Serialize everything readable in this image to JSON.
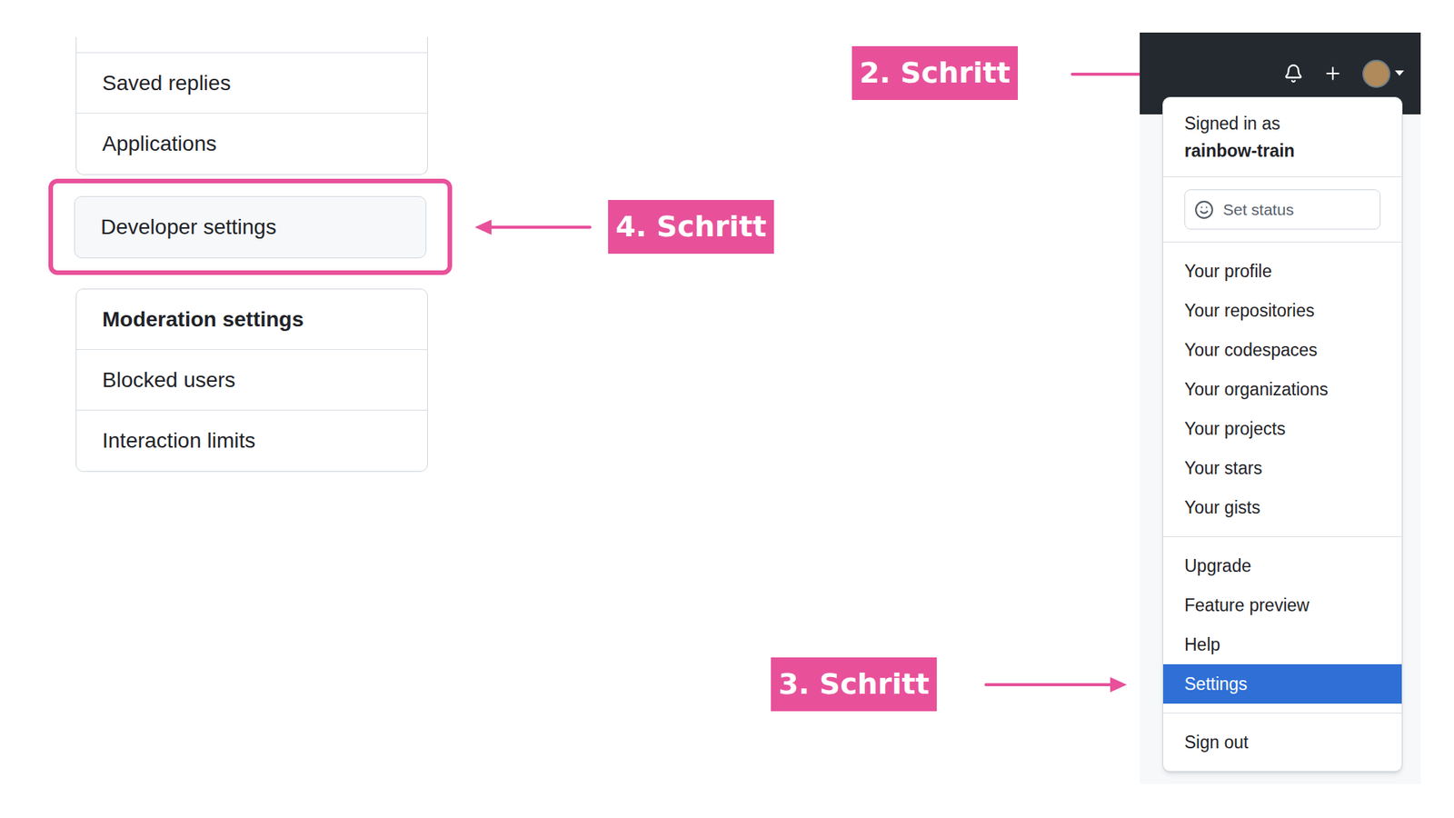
{
  "settings_sidebar": {
    "top_group": [
      {
        "label": "Saved replies",
        "selected": false
      },
      {
        "label": "Applications",
        "selected": false
      }
    ],
    "developer": {
      "label": "Developer settings",
      "selected": true,
      "highlighted": true
    },
    "moderation": {
      "title": "Moderation settings",
      "items": [
        {
          "label": "Blocked users",
          "selected": false
        },
        {
          "label": "Interaction limits",
          "selected": false
        }
      ]
    }
  },
  "annotations": [
    {
      "label": "2. Schritt",
      "target": "avatar"
    },
    {
      "label": "3. Schritt",
      "target": "settings"
    },
    {
      "label": "4. Schritt",
      "target": "developer-settings"
    }
  ],
  "user_menu": {
    "open": true,
    "signed_in_label": "Signed in as",
    "username": "rainbow-train",
    "status_button": "Set status",
    "sections": [
      [
        {
          "label": "Your profile",
          "selected": false
        },
        {
          "label": "Your repositories",
          "selected": false
        },
        {
          "label": "Your codespaces",
          "selected": false
        },
        {
          "label": "Your organizations",
          "selected": false
        },
        {
          "label": "Your projects",
          "selected": false
        },
        {
          "label": "Your stars",
          "selected": false
        },
        {
          "label": "Your gists",
          "selected": false
        }
      ],
      [
        {
          "label": "Upgrade",
          "selected": false
        },
        {
          "label": "Feature preview",
          "selected": false
        },
        {
          "label": "Help",
          "selected": false
        },
        {
          "label": "Settings",
          "selected": true
        }
      ],
      [
        {
          "label": "Sign out",
          "selected": false
        }
      ]
    ]
  }
}
